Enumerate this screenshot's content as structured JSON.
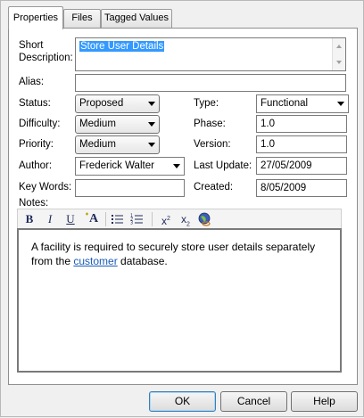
{
  "tabs": [
    {
      "label": "Properties"
    },
    {
      "label": "Files"
    },
    {
      "label": "Tagged Values"
    }
  ],
  "form": {
    "short_description_label": "Short Description:",
    "short_description_value": "Store User Details",
    "alias_label": "Alias:",
    "alias_value": "",
    "status_label": "Status:",
    "status_value": "Proposed",
    "difficulty_label": "Difficulty:",
    "difficulty_value": "Medium",
    "priority_label": "Priority:",
    "priority_value": "Medium",
    "author_label": "Author:",
    "author_value": "Frederick Walter",
    "keywords_label": "Key Words:",
    "keywords_value": "",
    "type_label": "Type:",
    "type_value": "Functional",
    "phase_label": "Phase:",
    "phase_value": "1.0",
    "version_label": "Version:",
    "version_value": "1.0",
    "last_update_label": "Last Update:",
    "last_update_value": "27/05/2009",
    "created_label": "Created:",
    "created_value": "8/05/2009",
    "notes_label": "Notes:"
  },
  "toolbar": {
    "bold": "B",
    "italic": "I",
    "underline": "U",
    "font_color": "A",
    "superscript_base": "x",
    "superscript_exp": "2",
    "subscript_base": "x",
    "subscript_exp": "2"
  },
  "notes": {
    "text_before": "A facility is required to securely store user details separately from the ",
    "link_text": "customer",
    "text_after": " database."
  },
  "buttons": {
    "ok": "OK",
    "cancel": "Cancel",
    "help": "Help"
  },
  "colors": {
    "selection": "#3399ff",
    "link": "#1a5cb5",
    "default_button_border": "#3c7fb1"
  }
}
